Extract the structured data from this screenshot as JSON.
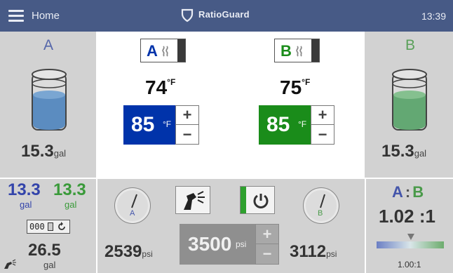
{
  "topbar": {
    "home_label": "Home",
    "brand": "RatioGuard",
    "time": "13:39"
  },
  "pump_a": {
    "letter": "A",
    "volume": "15.3",
    "unit": "gal",
    "heater_label": "A",
    "temp_actual": "74",
    "temp_unit": "°F",
    "setpoint": "85",
    "setpoint_unit": "°F",
    "color": "#0033aa"
  },
  "pump_b": {
    "letter": "B",
    "volume": "15.3",
    "unit": "gal",
    "heater_label": "B",
    "temp_actual": "75",
    "temp_unit": "°F",
    "setpoint": "85",
    "setpoint_unit": "°F",
    "color": "#1a8c1a"
  },
  "totals": {
    "a_value": "13.3",
    "b_value": "13.3",
    "a_unit": "gal",
    "b_unit": "gal",
    "counter": "000",
    "total": "26.5",
    "total_unit": "gal"
  },
  "pressure": {
    "gauge_a_label": "A",
    "gauge_b_label": "B",
    "a_value": "2539",
    "b_value": "3112",
    "unit": "psi",
    "setpoint": "3500",
    "setpoint_unit": "psi"
  },
  "ratio": {
    "label_a": "A",
    "sep": ":",
    "label_b": "B",
    "value": "1.02 :1",
    "target": "1.00:1",
    "bar_position": 0.51
  },
  "stepper": {
    "plus": "+",
    "minus": "−"
  }
}
